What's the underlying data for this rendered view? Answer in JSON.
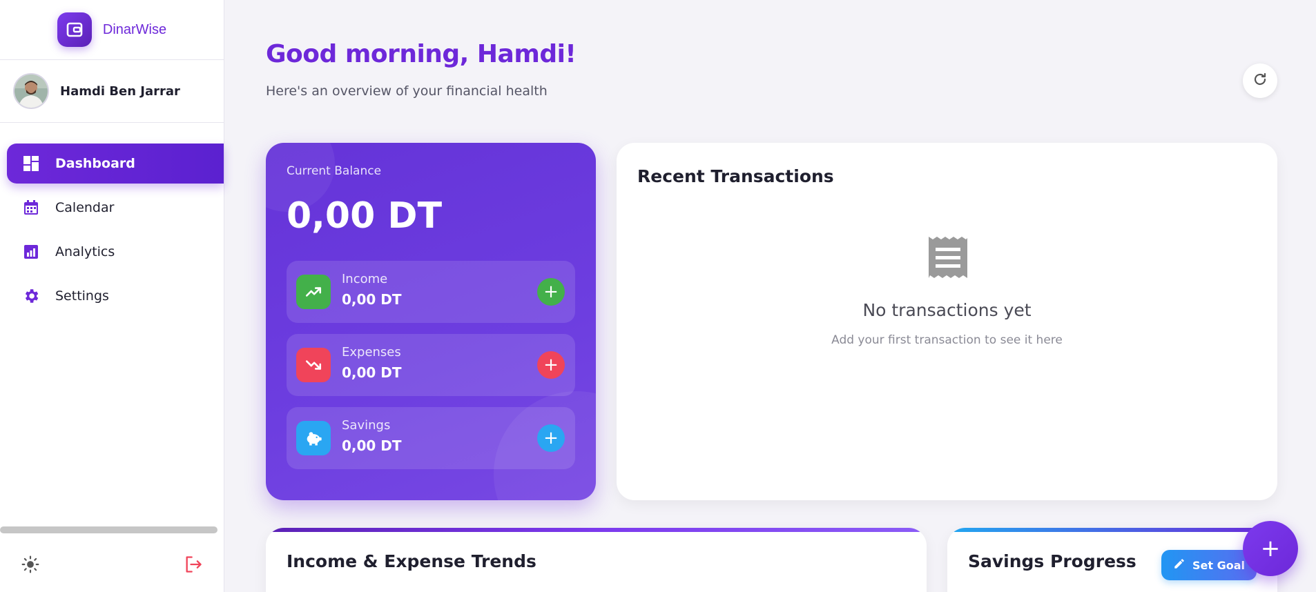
{
  "app": {
    "name": "DinarWise",
    "logo_icon": "wallet-icon",
    "accent": "#6d28d9"
  },
  "user": {
    "name": "Hamdi Ben Jarrar"
  },
  "nav": [
    {
      "label": "Dashboard",
      "icon": "dashboard-icon",
      "active": true
    },
    {
      "label": "Calendar",
      "icon": "calendar-icon",
      "active": false
    },
    {
      "label": "Analytics",
      "icon": "analytics-icon",
      "active": false
    },
    {
      "label": "Settings",
      "icon": "gear-icon",
      "active": false
    }
  ],
  "header": {
    "greeting": "Good morning, Hamdi!",
    "subtitle": "Here's an overview of your financial health"
  },
  "balance": {
    "label": "Current Balance",
    "amount": "0,00 DT",
    "stats": [
      {
        "name": "Income",
        "value": "0,00 DT",
        "icon": "trending-up-icon",
        "color": "#43b04a"
      },
      {
        "name": "Expenses",
        "value": "0,00 DT",
        "icon": "trending-down-icon",
        "color": "#f0445a"
      },
      {
        "name": "Savings",
        "value": "0,00 DT",
        "icon": "piggy-bank-icon",
        "color": "#2aa6f2"
      }
    ]
  },
  "transactions": {
    "title": "Recent Transactions",
    "empty_title": "No transactions yet",
    "empty_subtitle": "Add your first transaction to see it here"
  },
  "trends": {
    "title": "Income & Expense Trends"
  },
  "savings_progress": {
    "title": "Savings Progress",
    "set_goal_label": "Set Goal"
  }
}
